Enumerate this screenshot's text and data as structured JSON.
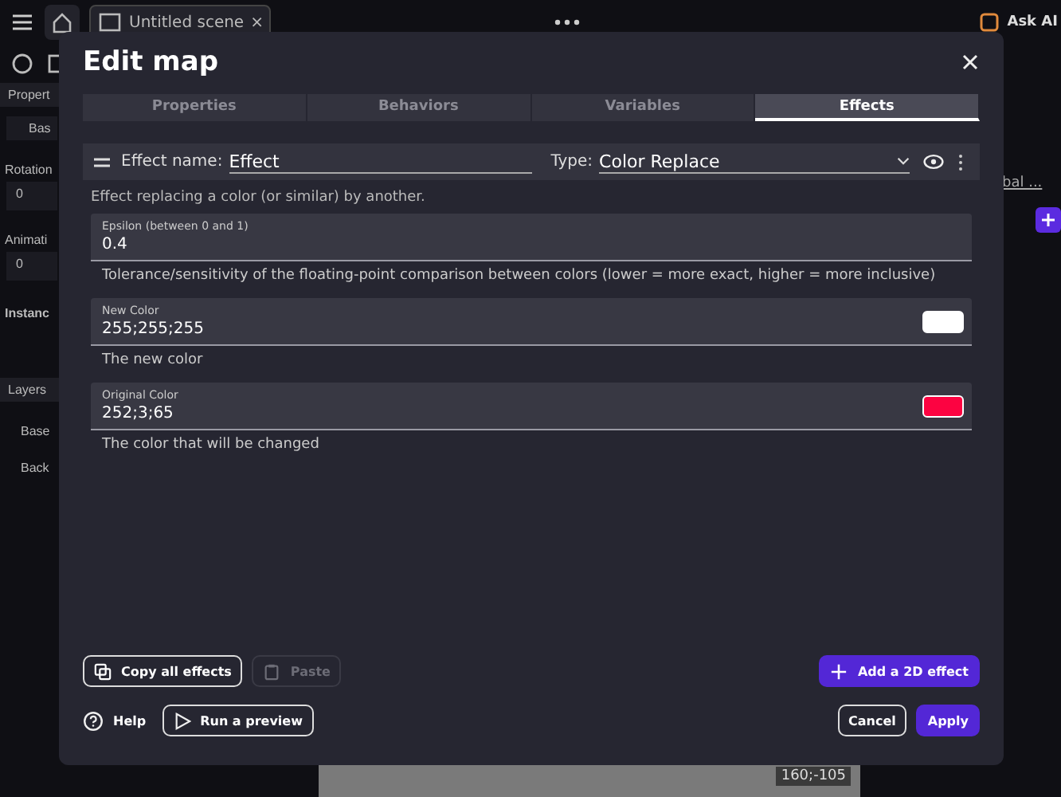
{
  "editor": {
    "tabs": [
      {
        "label": "Untitled scene",
        "close": "×",
        "selected": true
      }
    ],
    "ask_ai": "Ask AI",
    "left_panel": {
      "properties_title": "Propert",
      "layer_field": "Bas",
      "rotation_label": "Rotation",
      "rotation_value": "0",
      "animation_label": "Animati",
      "animation_value": "0",
      "instances_label": "Instanc",
      "layers_title": "Layers",
      "layers": [
        "Base",
        "Back"
      ]
    },
    "right_panel": {
      "link": "bal ..."
    },
    "canvas": {
      "coords": "160;-105"
    }
  },
  "dialog": {
    "title": "Edit map",
    "tabs": [
      {
        "label": "Properties",
        "selected": false
      },
      {
        "label": "Behaviors",
        "selected": false
      },
      {
        "label": "Variables",
        "selected": false
      },
      {
        "label": "Effects",
        "selected": true
      }
    ],
    "effect": {
      "name_label": "Effect name:",
      "name": "Effect",
      "type_label": "Type:",
      "type": "Color Replace"
    },
    "description": "Effect replacing a color (or similar) by another.",
    "parameters": [
      {
        "kind": "number",
        "label": "Epsilon (between 0 and 1)",
        "value": "0.4",
        "help": "Tolerance/sensitivity of the floating-point comparison between colors (lower = more exact, higher = more inclusive)"
      },
      {
        "kind": "color",
        "label": "New Color",
        "value": "255;255;255",
        "color": "#ffffff",
        "help": "The new color"
      },
      {
        "kind": "color",
        "label": "Original Color",
        "value": "252;3;65",
        "color": "#fc0341",
        "help": "The color that will be changed"
      }
    ],
    "copy_button": {
      "label": "Copy all effects",
      "disabled": false
    },
    "paste_button": {
      "label": "Paste",
      "disabled": true
    },
    "add_button": "Add a 2D effect",
    "help": "Help",
    "preview": "Run a preview",
    "cancel": "Cancel",
    "apply": "Apply"
  }
}
